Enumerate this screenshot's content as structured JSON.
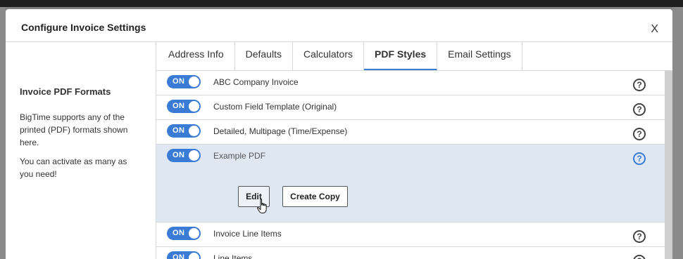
{
  "modal": {
    "title": "Configure Invoice Settings",
    "close_label": "X"
  },
  "sidebar": {
    "heading": "Invoice PDF Formats",
    "paragraph1": "BigTime supports any of the printed (PDF) formats shown here.",
    "paragraph2": "You can activate as many as you need!"
  },
  "tabs": [
    {
      "label": "Address Info",
      "active": false
    },
    {
      "label": "Defaults",
      "active": false
    },
    {
      "label": "Calculators",
      "active": false
    },
    {
      "label": "PDF Styles",
      "active": true
    },
    {
      "label": "Email Settings",
      "active": false
    }
  ],
  "formats": [
    {
      "toggle": "ON",
      "name": "ABC Company Invoice",
      "help": "?"
    },
    {
      "toggle": "ON",
      "name": "Custom Field Template (Original)",
      "help": "?"
    },
    {
      "toggle": "ON",
      "name": "Detailed, Multipage (Time/Expense)",
      "help": "?"
    },
    {
      "toggle": "ON",
      "name": "Example PDF",
      "help": "?",
      "expanded": true,
      "edit_label": "Edit",
      "copy_label": "Create Copy"
    },
    {
      "toggle": "ON",
      "name": "Invoice Line Items",
      "help": "?"
    },
    {
      "toggle": "ON",
      "name": "Line Items",
      "help": "?"
    }
  ],
  "colors": {
    "accent": "#3a7bd5",
    "expanded_row": "#dfe7f2",
    "overlay": "#7f7f7f"
  }
}
